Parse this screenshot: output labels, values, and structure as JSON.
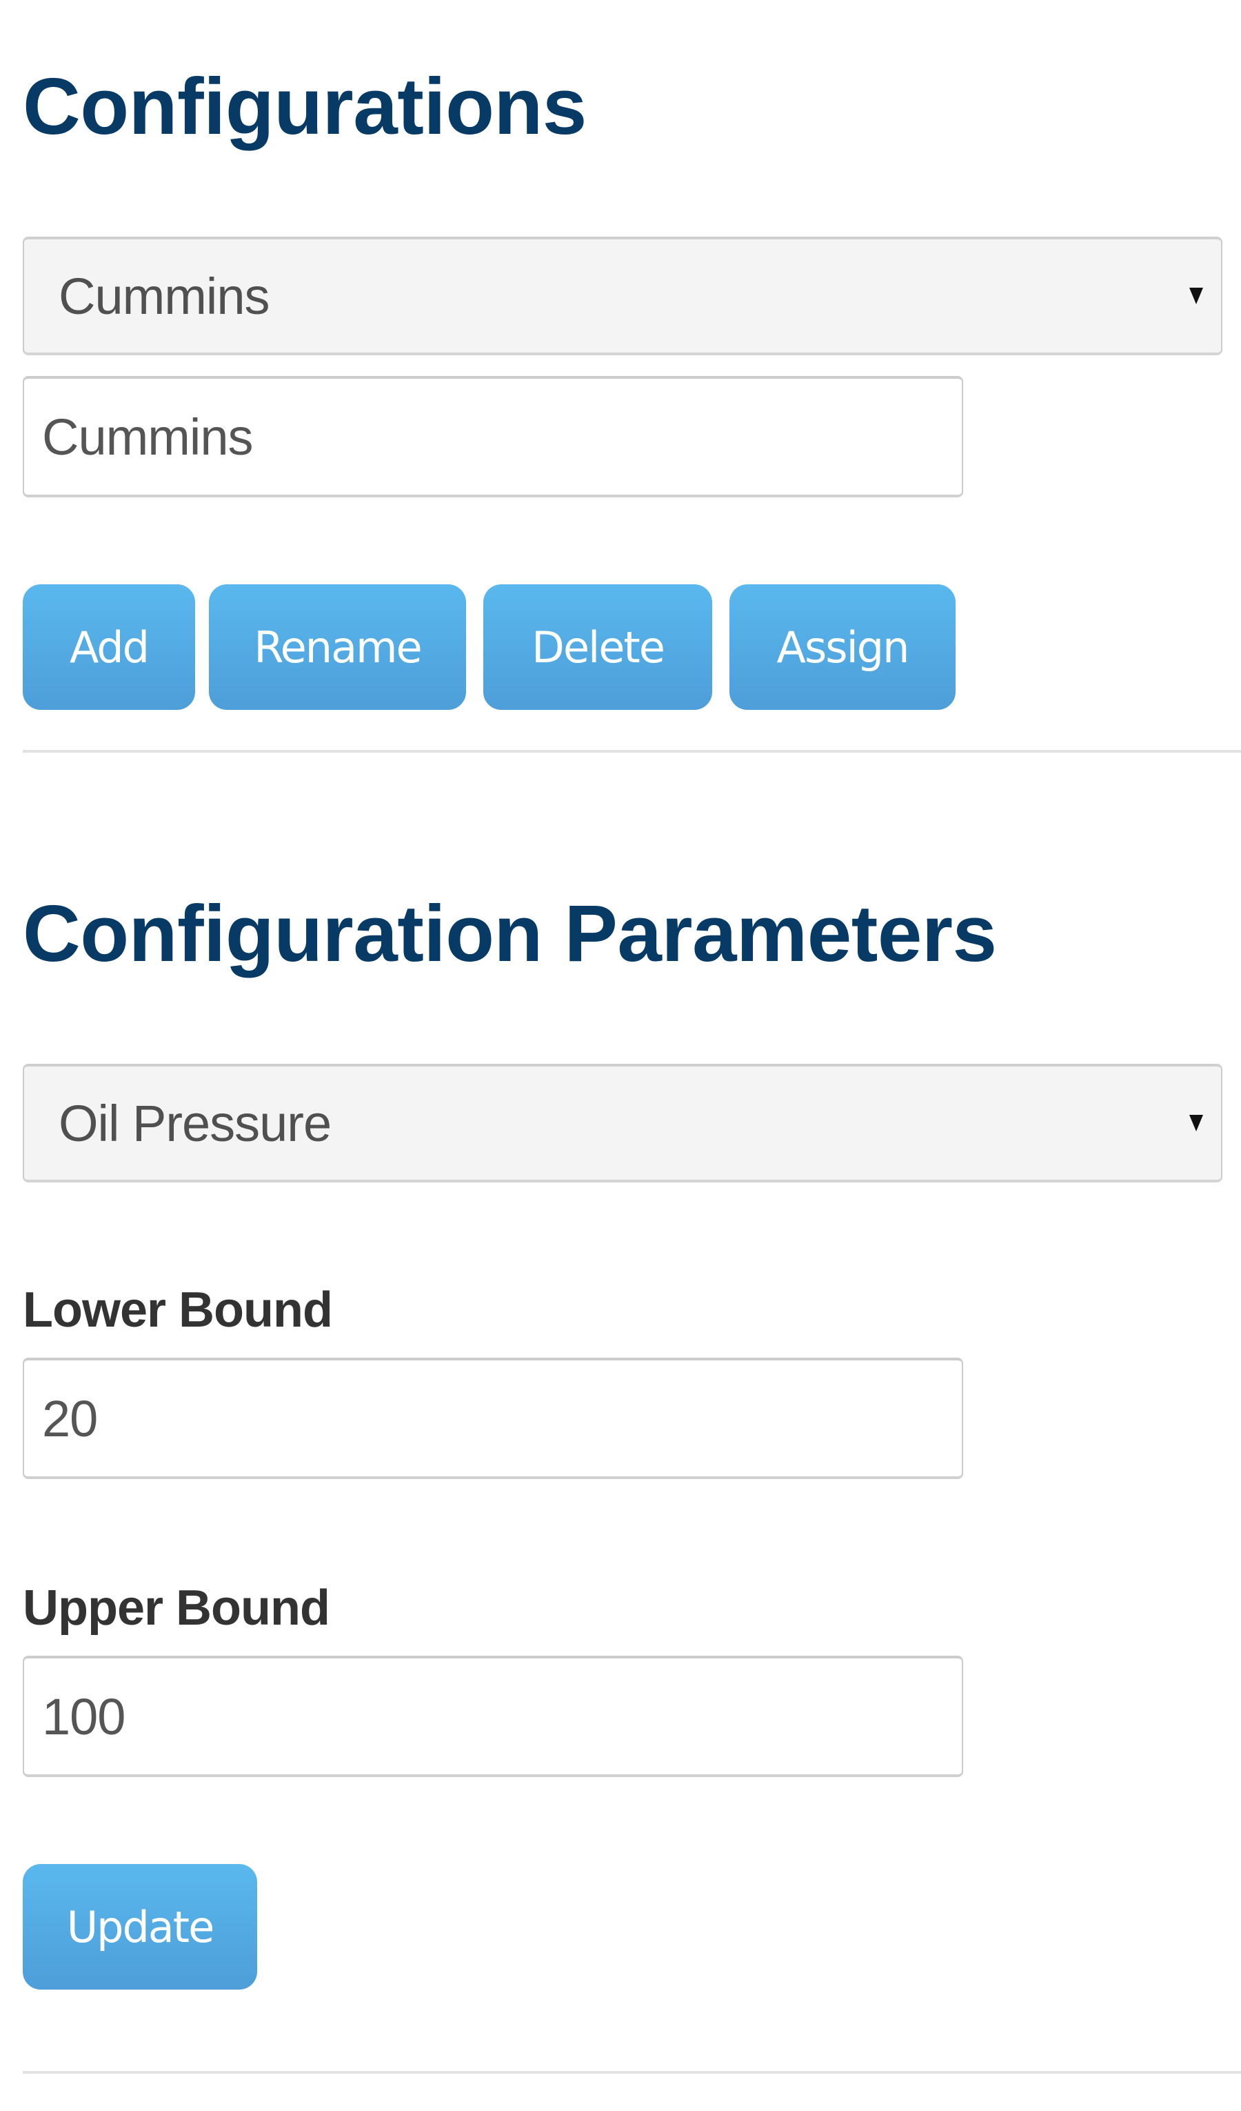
{
  "configurations": {
    "title": "Configurations",
    "select": {
      "selected": "Cummins"
    },
    "name_input": {
      "value": "Cummins"
    },
    "buttons": {
      "add": "Add",
      "rename": "Rename",
      "delete": "Delete",
      "assign": "Assign"
    }
  },
  "parameters": {
    "title": "Configuration Parameters",
    "select": {
      "selected": "Oil Pressure"
    },
    "lower_bound": {
      "label": "Lower Bound",
      "value": "20"
    },
    "upper_bound": {
      "label": "Upper Bound",
      "value": "100"
    },
    "update_button": "Update"
  },
  "colors": {
    "heading": "#083a66",
    "button_top": "#5ab8ee",
    "button_bottom": "#4d9ed9",
    "select_bg": "#f4f4f4",
    "divider": "#e2e2e2"
  }
}
